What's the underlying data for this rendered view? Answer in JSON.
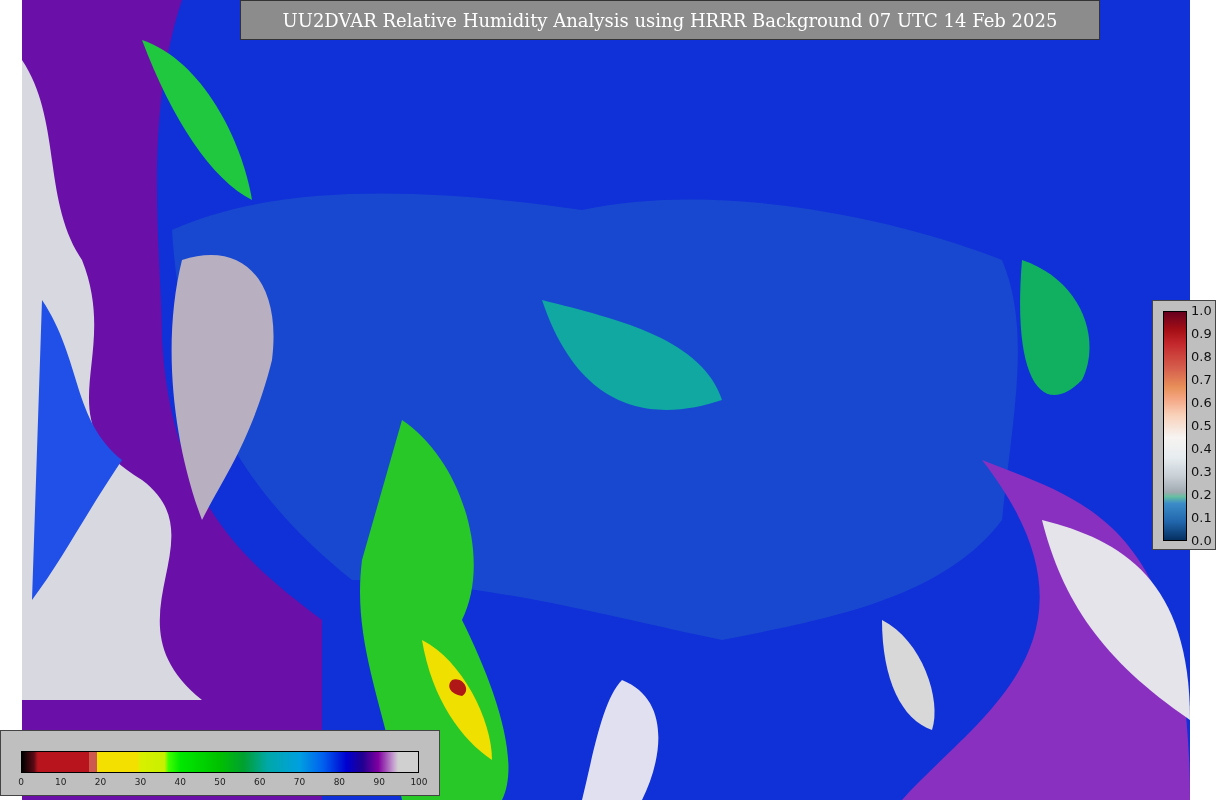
{
  "title": "UU2DVAR Relative Humidity Analysis using HRRR Background 07 UTC 14 Feb 2025",
  "right_colorbar": {
    "tick_labels": [
      "1.0",
      "0.9",
      "0.8",
      "0.7",
      "0.6",
      "0.5",
      "0.4",
      "0.3",
      "0.2",
      "0.1",
      "0.0"
    ]
  },
  "bottom_colorbar": {
    "tick_labels": [
      "0",
      "10",
      "20",
      "30",
      "40",
      "50",
      "60",
      "70",
      "80",
      "90",
      "100"
    ]
  }
}
